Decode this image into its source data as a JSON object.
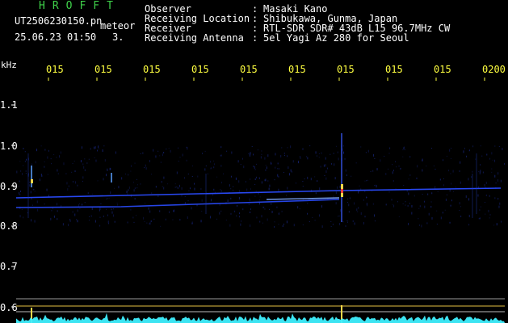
{
  "header": {
    "brand": "HROFFT",
    "filename": "UT2506230150.pn",
    "category": "meteor",
    "datetime": "25.06.23 01:50",
    "counter": "3.",
    "fields": [
      {
        "key": "Observer",
        "value": "Masaki Kano"
      },
      {
        "key": "Receiving Location",
        "value": "Shibukawa, Gunma, Japan"
      },
      {
        "key": "Receiver",
        "value": "RTL-SDR SDR# 43dB L15 96.7MHz CW"
      },
      {
        "key": "Receiving Antenna",
        "value": "5el Yagi Az 280 for Seoul"
      }
    ],
    "separator": ":"
  },
  "axis": {
    "unit": "kHz",
    "y_ticks": [
      "1.1",
      "1.0",
      "0.9",
      "0.8",
      "0.7",
      "0.6"
    ],
    "x_ticks": [
      "015",
      "015",
      "015",
      "015",
      "015",
      "015",
      "015",
      "015",
      "015",
      "0200"
    ]
  },
  "colors": {
    "text_green": "#3fd14a",
    "text_white": "#ffffff",
    "tick_yellow": "#ffff40",
    "signal_blue": "#2a4cff",
    "meteor_yellow": "#ffd84a",
    "noise_cyan": "#3ff0ff"
  }
}
